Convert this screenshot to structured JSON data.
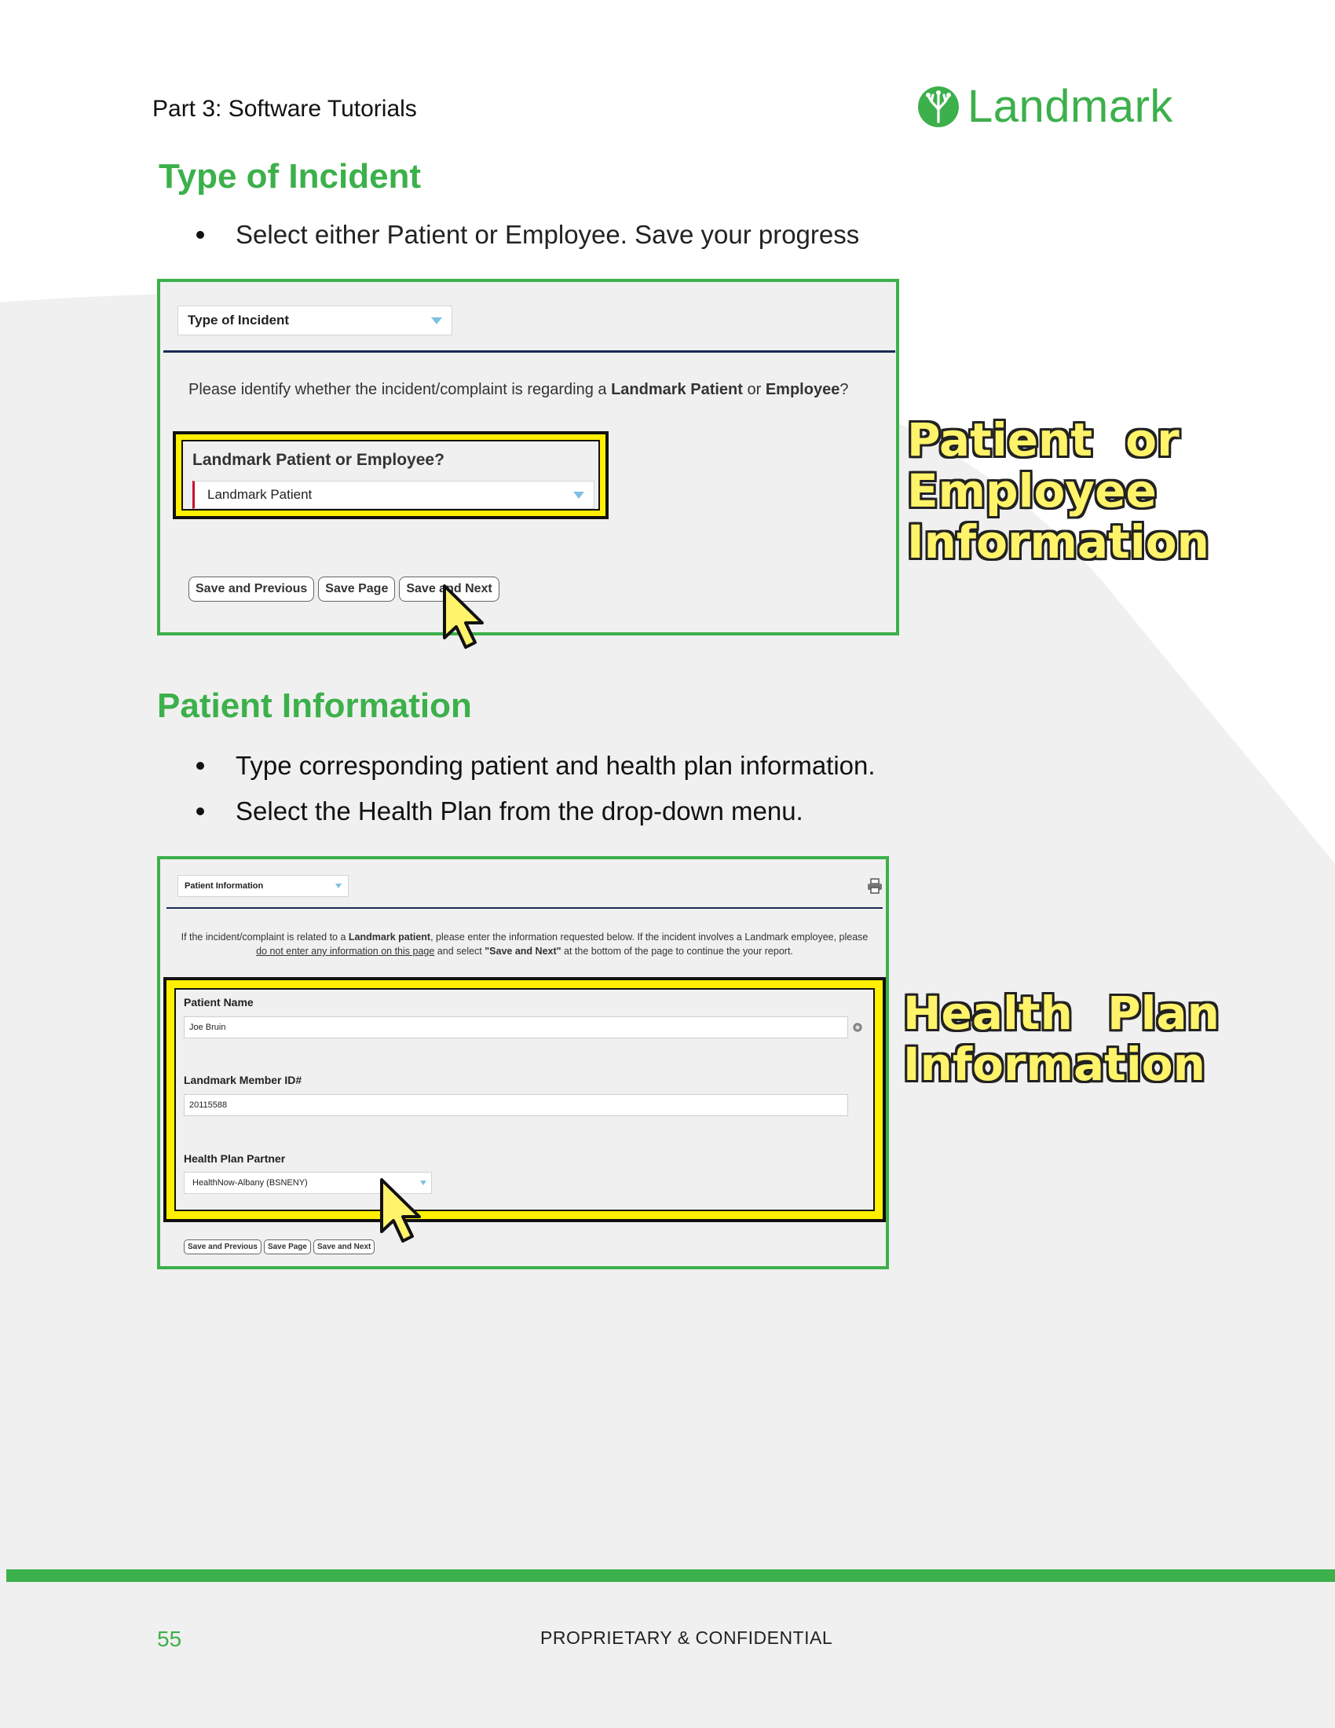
{
  "header": {
    "part_label": "Part 3: Software Tutorials",
    "logo_text": "Landmark"
  },
  "section1": {
    "title": "Type of Incident",
    "bullet_1": "Select either Patient or Employee. Save your progress"
  },
  "screenshot1": {
    "dropdown_label": "Type of Incident",
    "prompt_prefix": "Please identify whether the incident/complaint is regarding a ",
    "prompt_bold_1": "Landmark Patient",
    "prompt_mid": " or ",
    "prompt_bold_2": "Employee",
    "prompt_suffix": "?",
    "field_label": "Landmark Patient or Employee?",
    "field_value": "Landmark Patient",
    "buttons": {
      "save_previous": "Save and Previous",
      "save_page": "Save Page",
      "save_next": "Save and Next"
    }
  },
  "callout1": {
    "line1": "Patient or",
    "line2": "Employee",
    "line3": "Information"
  },
  "section2": {
    "title": "Patient Information",
    "bullet_1": "Type corresponding patient and health plan information.",
    "bullet_2": "Select the Health Plan from the drop-down menu."
  },
  "screenshot2": {
    "dropdown_label": "Patient Information",
    "instr_1a": "If the incident/complaint is related to a ",
    "instr_1b": "Landmark patient",
    "instr_1c": ", please enter the information requested below. If the incident involves a Landmark employee, please",
    "instr_2a": "do not enter any information on this page",
    "instr_2b": " and select ",
    "instr_2c": "\"Save and Next\"",
    "instr_2d": " at the bottom of the page to continue the your report.",
    "patient_name_label": "Patient Name",
    "patient_name_value": "Joe Bruin",
    "member_id_label": "Landmark Member ID#",
    "member_id_value": "20115588",
    "health_plan_label": "Health Plan Partner",
    "health_plan_value": "HealthNow-Albany (BSNENY)",
    "buttons": {
      "save_previous": "Save and Previous",
      "save_page": "Save Page",
      "save_next": "Save and Next"
    }
  },
  "callout2": {
    "line1": "Health Plan",
    "line2": "Information"
  },
  "footer": {
    "page_number": "55",
    "confidential": "PROPRIETARY & CONFIDENTIAL"
  },
  "colors": {
    "brand_green": "#3cb04a",
    "highlight_yellow": "#ffef00",
    "background_gray": "#f0f0f0"
  }
}
